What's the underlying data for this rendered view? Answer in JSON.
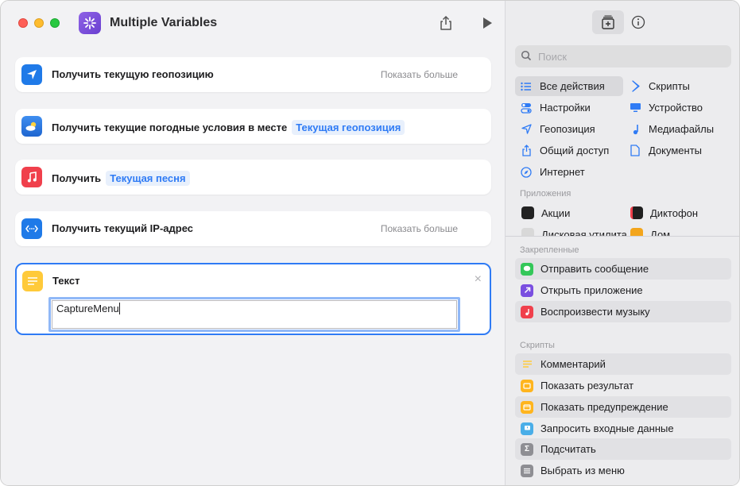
{
  "window": {
    "title": "Multiple Variables"
  },
  "actions": [
    {
      "label": "Получить текущую геопозицию",
      "more": "Показать больше",
      "icon": "location-arrow-icon",
      "color": "#1f7ae8"
    },
    {
      "label": "Получить текущие погодные условия в месте",
      "token": "Текущая геопозиция",
      "icon": "weather-icon",
      "color": "#2a7ce0"
    },
    {
      "label": "Получить",
      "token": "Текущая песня",
      "icon": "music-note-icon",
      "color": "#f0404c"
    },
    {
      "label": "Получить текущий IP-адрес",
      "more": "Показать больше",
      "icon": "network-icon",
      "color": "#1f7ae8"
    }
  ],
  "text_action": {
    "label": "Текст",
    "value": "CaptureMenu",
    "icon": "text-lines-icon",
    "color": "#ffca3a"
  },
  "sidebar": {
    "search_placeholder": "Поиск",
    "categories_left": [
      {
        "label": "Все действия",
        "icon": "list-icon",
        "selected": true
      },
      {
        "label": "Настройки",
        "icon": "toggle-icon"
      },
      {
        "label": "Геопозиция",
        "icon": "location-icon"
      },
      {
        "label": "Общий доступ",
        "icon": "share-icon"
      },
      {
        "label": "Интернет",
        "icon": "compass-icon"
      }
    ],
    "categories_right": [
      {
        "label": "Скрипты",
        "icon": "script-icon"
      },
      {
        "label": "Устройство",
        "icon": "display-icon"
      },
      {
        "label": "Медиафайлы",
        "icon": "music-icon"
      },
      {
        "label": "Документы",
        "icon": "document-icon"
      }
    ],
    "apps_section": "Приложения",
    "apps": [
      {
        "label": "Акции",
        "color": "#222222"
      },
      {
        "label": "Диктофон",
        "color": "#1f1f1f"
      },
      {
        "label": "Дисковая утилита",
        "color": "#d8d8d8"
      },
      {
        "label": "Дом",
        "color": "#f3a51c"
      }
    ],
    "pinned_section": "Закрепленные",
    "pinned": [
      {
        "label": "Отправить сообщение",
        "icon": "message-icon",
        "color": "#34c759"
      },
      {
        "label": "Открыть приложение",
        "icon": "open-app-icon",
        "color": "#7a4fe0"
      },
      {
        "label": "Воспроизвести музыку",
        "icon": "music-play-icon",
        "color": "#f0404c"
      }
    ],
    "scripts_section": "Скрипты",
    "scripts": [
      {
        "label": "Комментарий",
        "icon": "comment-icon",
        "color": "#ffca3a"
      },
      {
        "label": "Показать результат",
        "icon": "show-result-icon",
        "color": "#ffb51e"
      },
      {
        "label": "Показать предупреждение",
        "icon": "alert-icon",
        "color": "#ffb51e"
      },
      {
        "label": "Запросить входные данные",
        "icon": "ask-input-icon",
        "color": "#4aaee8"
      },
      {
        "label": "Подсчитать",
        "icon": "sigma-icon",
        "color": "#8e8e93"
      },
      {
        "label": "Выбрать из меню",
        "icon": "menu-icon",
        "color": "#8e8e93"
      }
    ]
  }
}
